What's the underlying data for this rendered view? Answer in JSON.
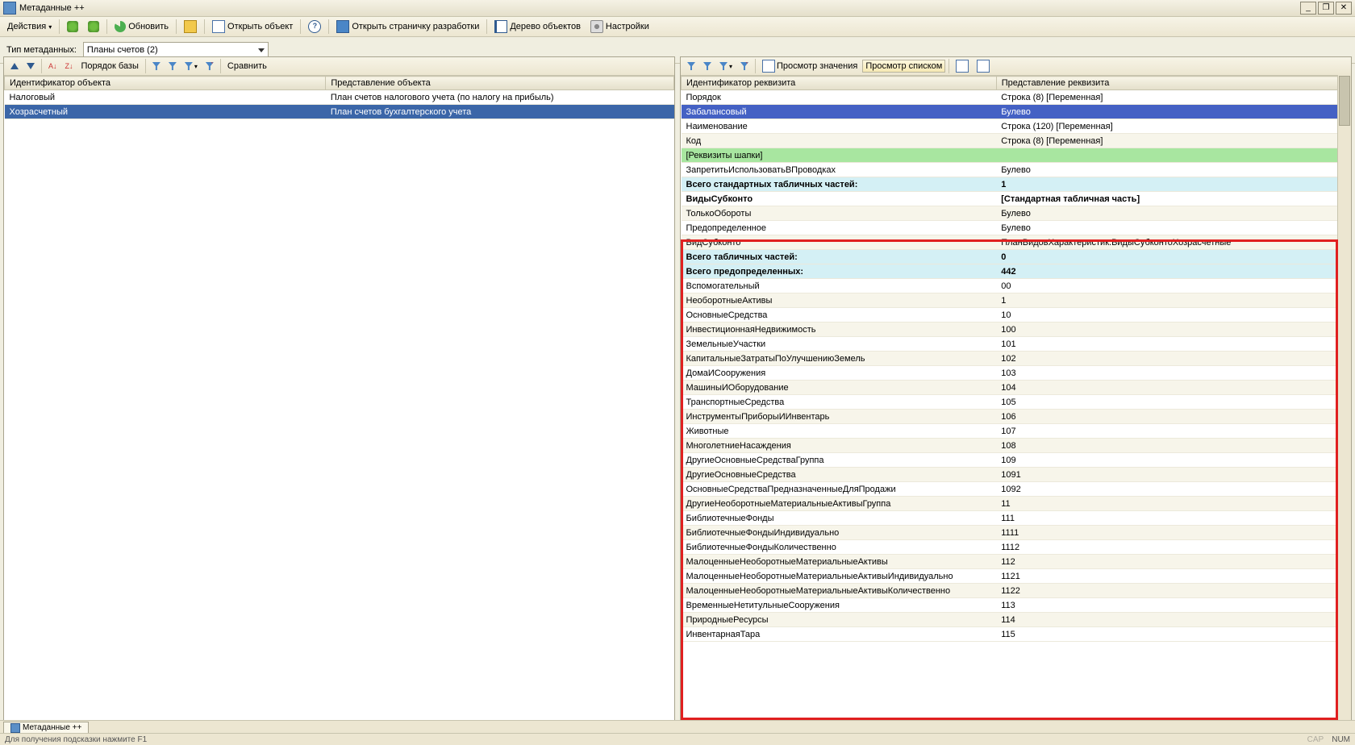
{
  "title": "Метаданные ++",
  "toolbar": {
    "actions": "Действия",
    "refresh": "Обновить",
    "open_object": "Открыть объект",
    "open_dev_page": "Открыть страничку разработки",
    "object_tree": "Дерево объектов",
    "settings": "Настройки"
  },
  "filter": {
    "label": "Тип метаданных:",
    "value": "Планы счетов (2)"
  },
  "left_toolbar": {
    "order_db": "Порядок базы",
    "compare": "Сравнить"
  },
  "left_grid": {
    "headers": [
      "Идентификатор объекта",
      "Представление объекта"
    ],
    "rows": [
      {
        "id": "Налоговый",
        "repr": "План счетов налогового учета (по налогу на прибыль)",
        "sel": false
      },
      {
        "id": "Хозрасчетный",
        "repr": "План счетов бухгалтерского учета",
        "sel": true
      }
    ]
  },
  "right_toolbar": {
    "view_value": "Просмотр значения",
    "view_list": "Просмотр списком"
  },
  "right_grid": {
    "headers": [
      "Идентификатор реквизита",
      "Представление реквизита"
    ],
    "rows": [
      {
        "id": "Порядок",
        "val": "Строка (8) [Переменная]",
        "cls": ""
      },
      {
        "id": "Забалансовый",
        "val": "Булево",
        "cls": "sel-blue"
      },
      {
        "id": "Наименование",
        "val": "Строка (120) [Переменная]",
        "cls": ""
      },
      {
        "id": "Код",
        "val": "Строка (8) [Переменная]",
        "cls": "alt"
      },
      {
        "id": "[Реквизиты шапки]",
        "val": "",
        "cls": "green"
      },
      {
        "id": "ЗапретитьИспользоватьВПроводках",
        "val": "Булево",
        "cls": ""
      },
      {
        "id": "Всего стандартных табличных частей:",
        "val": "1",
        "cls": "cyan bold"
      },
      {
        "id": "ВидыСубконто",
        "val": "[Стандартная табличная часть]",
        "cls": "bold"
      },
      {
        "id": "ТолькоОбороты",
        "val": "Булево",
        "cls": "alt"
      },
      {
        "id": "Предопределенное",
        "val": "Булево",
        "cls": ""
      },
      {
        "id": "ВидСубконто",
        "val": "ПланВидовХарактеристик.ВидыСубконтоХозрасчетные",
        "cls": "alt"
      },
      {
        "id": "Всего табличных частей:",
        "val": "0",
        "cls": "cyan bold"
      },
      {
        "id": "Всего предопределенных:",
        "val": "442",
        "cls": "cyan bold"
      },
      {
        "id": "Вспомогательный",
        "val": "00",
        "cls": ""
      },
      {
        "id": "НеоборотныеАктивы",
        "val": "1",
        "cls": "alt"
      },
      {
        "id": "ОсновныеСредства",
        "val": "10",
        "cls": ""
      },
      {
        "id": "ИнвестиционнаяНедвижимость",
        "val": "100",
        "cls": "alt"
      },
      {
        "id": "ЗемельныеУчастки",
        "val": "101",
        "cls": ""
      },
      {
        "id": "КапитальныеЗатратыПоУлучшениюЗемель",
        "val": "102",
        "cls": "alt"
      },
      {
        "id": "ДомаИСооружения",
        "val": "103",
        "cls": ""
      },
      {
        "id": "МашиныИОборудование",
        "val": "104",
        "cls": "alt"
      },
      {
        "id": "ТранспортныеСредства",
        "val": "105",
        "cls": ""
      },
      {
        "id": "ИнструментыПриборыИИнвентарь",
        "val": "106",
        "cls": "alt"
      },
      {
        "id": "Животные",
        "val": "107",
        "cls": ""
      },
      {
        "id": "МноголетниеНасаждения",
        "val": "108",
        "cls": "alt"
      },
      {
        "id": "ДругиеОсновныеСредстваГруппа",
        "val": "109",
        "cls": ""
      },
      {
        "id": "ДругиеОсновныеСредства",
        "val": "1091",
        "cls": "alt"
      },
      {
        "id": "ОсновныеСредстваПредназначенныеДляПродажи",
        "val": "1092",
        "cls": ""
      },
      {
        "id": "ДругиеНеоборотныеМатериальныеАктивыГруппа",
        "val": "11",
        "cls": "alt"
      },
      {
        "id": "БиблиотечныеФонды",
        "val": "111",
        "cls": ""
      },
      {
        "id": "БиблиотечныеФондыИндивидуально",
        "val": "1111",
        "cls": "alt"
      },
      {
        "id": "БиблиотечныеФондыКоличественно",
        "val": "1112",
        "cls": ""
      },
      {
        "id": "МалоценныеНеоборотныеМатериальныеАктивы",
        "val": "112",
        "cls": "alt"
      },
      {
        "id": "МалоценныеНеоборотныеМатериальныеАктивыИндивидуально",
        "val": "1121",
        "cls": ""
      },
      {
        "id": "МалоценныеНеоборотныеМатериальныеАктивыКоличественно",
        "val": "1122",
        "cls": "alt"
      },
      {
        "id": "ВременныеНетитульныеСооружения",
        "val": "113",
        "cls": ""
      },
      {
        "id": "ПриродныеРесурсы",
        "val": "114",
        "cls": "alt"
      },
      {
        "id": "ИнвентарнаяТара",
        "val": "115",
        "cls": ""
      }
    ]
  },
  "bottom_tab": "Метаданные ++",
  "status": {
    "hint": "Для получения подсказки нажмите F1",
    "cap": "CAP",
    "num": "NUM"
  }
}
